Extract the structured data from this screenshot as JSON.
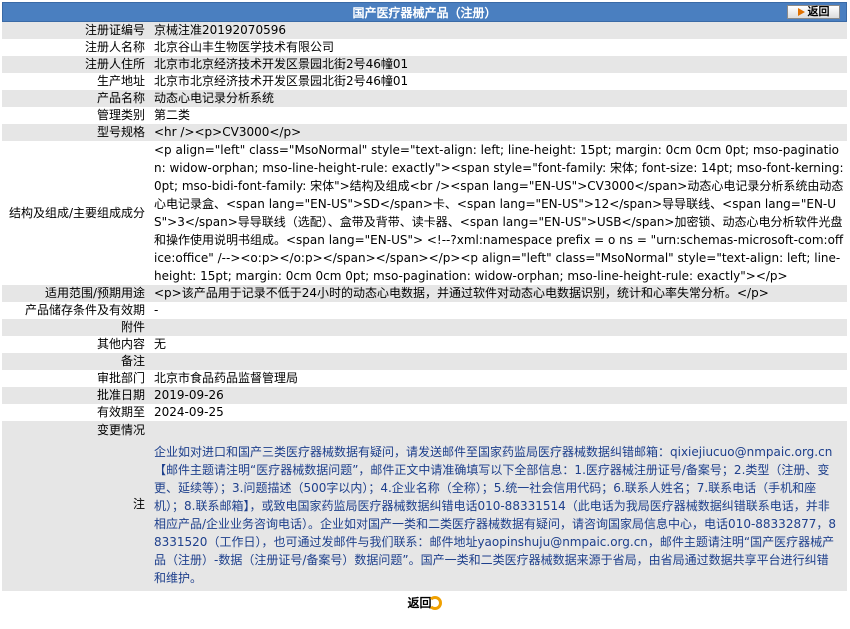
{
  "header": {
    "title": "国产医疗器械产品（注册）",
    "back_label": "返回"
  },
  "rows": [
    {
      "label": "注册证编号",
      "value": "京械注准20192070596"
    },
    {
      "label": "注册人名称",
      "value": "北京谷山丰生物医学技术有限公司"
    },
    {
      "label": "注册人住所",
      "value": "北京市北京经济技术开发区景园北街2号46幢01"
    },
    {
      "label": "生产地址",
      "value": "北京市北京经济技术开发区景园北街2号46幢01"
    },
    {
      "label": "产品名称",
      "value": "动态心电记录分析系统"
    },
    {
      "label": "管理类别",
      "value": "第二类"
    },
    {
      "label": "型号规格",
      "value": "<hr /><p>CV3000</p>"
    },
    {
      "label": "结构及组成/主要组成成分",
      "value": "<p align=\"left\" class=\"MsoNormal\" style=\"text-align: left; line-height: 15pt; margin: 0cm 0cm 0pt; mso-pagination: widow-orphan; mso-line-height-rule: exactly\"><span style=\"font-family: 宋体; font-size: 14pt; mso-font-kerning: 0pt; mso-bidi-font-family: 宋体\">结构及组成<br /><span lang=\"EN-US\">CV3000</span>动态心电记录分析系统由动态心电记录盒、<span lang=\"EN-US\">SD</span>卡、<span lang=\"EN-US\">12</span>导导联线、<span lang=\"EN-US\">3</span>导导联线（选配）、盒带及背带、读卡器、<span lang=\"EN-US\">USB</span>加密锁、动态心电分析软件光盘和操作使用说明书组成。<span lang=\"EN-US\"> <!--?xml:namespace prefix = o ns = \"urn:schemas-microsoft-com:office:office\" /--><o:p></o:p></span></span></p><p align=\"left\" class=\"MsoNormal\" style=\"text-align: left; line-height: 15pt; margin: 0cm 0cm 0pt; mso-pagination: widow-orphan; mso-line-height-rule: exactly\"></p>"
    },
    {
      "label": "适用范围/预期用途",
      "value": "<p>该产品用于记录不低于24小时的动态心电数据，并通过软件对动态心电数据识别，统计和心率失常分析。</p>"
    },
    {
      "label": "产品储存条件及有效期",
      "value": "-"
    },
    {
      "label": "附件",
      "value": ""
    },
    {
      "label": "其他内容",
      "value": "无"
    },
    {
      "label": "备注",
      "value": ""
    },
    {
      "label": "审批部门",
      "value": "北京市食品药品监督管理局"
    },
    {
      "label": "批准日期",
      "value": "2019-09-26"
    },
    {
      "label": "有效期至",
      "value": "2024-09-25"
    }
  ],
  "note": {
    "change_label": "变更情况",
    "note_label": "注",
    "text": "企业如对进口和国产三类医疗器械数据有疑问，请发送邮件至国家药监局医疗器械数据纠错邮箱：qixiejiucuo@nmpaic.org.cn【邮件主题请注明“医疗器械数据问题”，邮件正文中请准确填写以下全部信息：1.医疗器械注册证号/备案号；2.类型（注册、变更、延续等）；3.问题描述（500字以内）；4.企业名称（全称）；5.统一社会信用代码；6.联系人姓名；7.联系电话（手机和座机）；8.联系邮箱】，或致电国家药监局医疗器械数据纠错电话010-88331514（此电话为我局医疗器械数据纠错联系电话，并非相应产品/企业业务咨询电话）。企业如对国产一类和二类医疗器械数据有疑问，请咨询国家局信息中心，电话010-88332877，88331520（工作日），也可通过发邮件与我们联系：邮件地址yaopinshuju@nmpaic.org.cn，邮件主题请注明“国产医疗器械产品（注册）-数据（注册证号/备案号）数据问题”。国产一类和二类医疗器械数据来源于省局，由省局通过数据共享平台进行纠错和维护。"
  },
  "footer": {
    "back_label": "返回"
  }
}
